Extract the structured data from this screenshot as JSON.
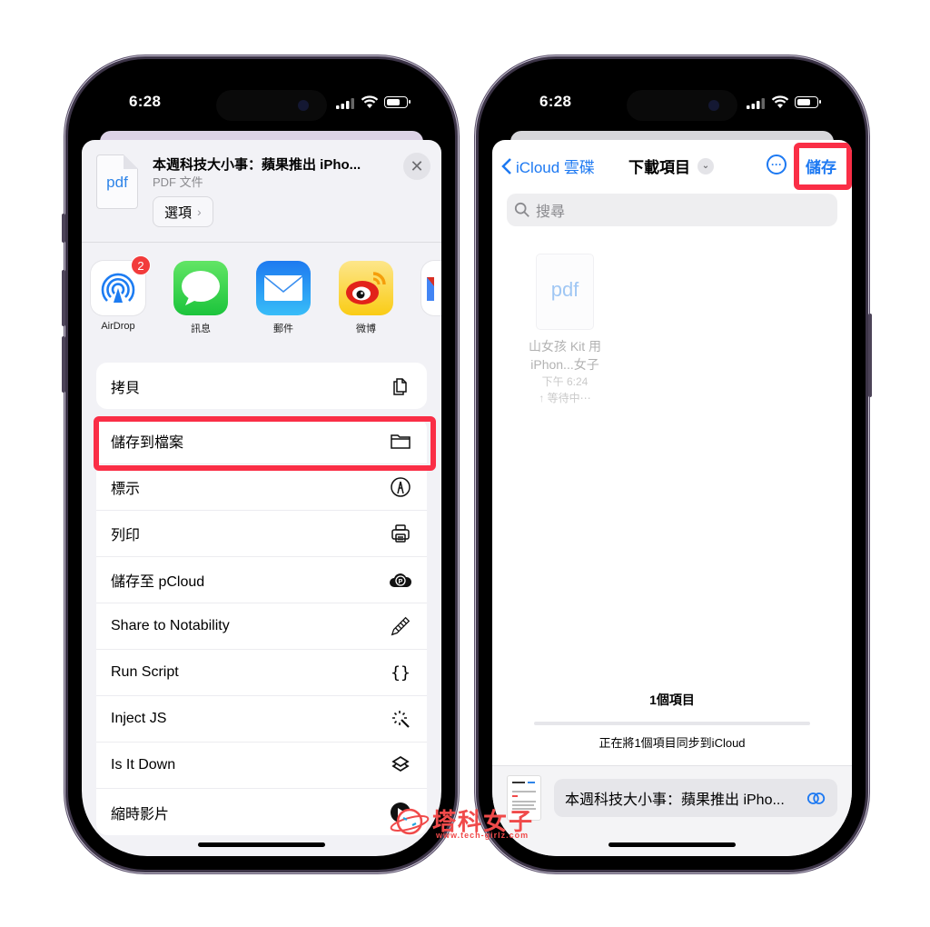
{
  "left_phone": {
    "status_bar": {
      "time": "6:28"
    },
    "share_header": {
      "doc_icon_label": "pdf",
      "title": "本週科技大小事：蘋果推出 iPho...",
      "subtitle": "PDF 文件",
      "options_label": "選項",
      "options_chevron": "›",
      "close_glyph": "✕"
    },
    "apps": [
      {
        "name": "AirDrop",
        "icon": "airdrop-icon",
        "badge": "2"
      },
      {
        "name": "訊息",
        "icon": "messages-icon"
      },
      {
        "name": "郵件",
        "icon": "mail-icon"
      },
      {
        "name": "微博",
        "icon": "weibo-icon"
      }
    ],
    "actions": [
      {
        "label": "拷貝",
        "icon": "copy-icon"
      },
      {
        "label": "儲存到檔案",
        "icon": "folder-icon",
        "highlighted": true
      },
      {
        "label": "標示",
        "icon": "markup-icon"
      },
      {
        "label": "列印",
        "icon": "printer-icon"
      },
      {
        "label": "儲存至 pCloud",
        "icon": "pcloud-icon"
      },
      {
        "label": "Share to Notability",
        "icon": "pencil-icon"
      },
      {
        "label": "Run Script",
        "icon": "braces-icon"
      },
      {
        "label": "Inject JS",
        "icon": "magic-wand-icon"
      },
      {
        "label": "Is It Down",
        "icon": "shortcuts-icon"
      },
      {
        "label": "縮時影片",
        "icon": "timelapse-icon"
      }
    ]
  },
  "right_phone": {
    "status_bar": {
      "time": "6:28"
    },
    "nav": {
      "back_label": "iCloud 雲碟",
      "title": "下載項目",
      "save_label": "儲存"
    },
    "search": {
      "placeholder": "搜尋"
    },
    "file": {
      "icon_label": "pdf",
      "name_line1": "山女孩 Kit 用",
      "name_line2": "iPhon...女子",
      "time": "下午 6:24",
      "status": "↑ 等待中⋯"
    },
    "count_label": "1個項目",
    "sync_progress_percent": 0,
    "sync_text": "正在將1個項目同步到iCloud",
    "filename_field": "本週科技大小事：蘋果推出 iPho..."
  },
  "watermark": {
    "text": "塔科女子",
    "url": "www.tech-girlz.com"
  },
  "colors": {
    "accent_blue": "#1d79f2",
    "highlight_red": "#fa2e46",
    "badge_red": "#f23b3b"
  }
}
